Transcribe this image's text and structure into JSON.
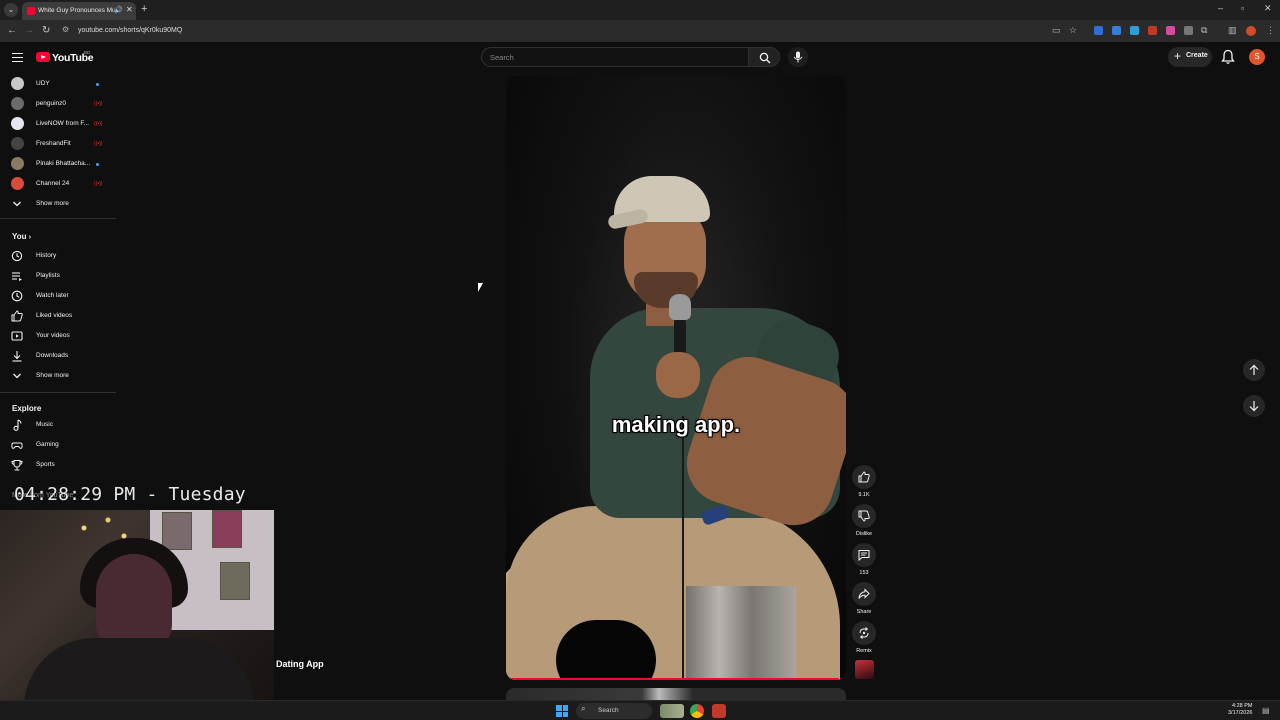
{
  "browser": {
    "tab_title": "White Guy Pronounces Mu",
    "url": "youtube.com/shorts/qKr0ku90MQ"
  },
  "masthead": {
    "logo_text": "YouTube",
    "country_code": "BD",
    "search_placeholder": "Search",
    "create_label": "Create",
    "avatar_letter": "S"
  },
  "sidebar": {
    "subscriptions": [
      {
        "label": "UDY",
        "indicator": "dot",
        "color": "#c9c9c9"
      },
      {
        "label": "penguinz0",
        "indicator": "live",
        "color": "#6b6b6b"
      },
      {
        "label": "LiveNOW from F...",
        "indicator": "live",
        "color": "#e6e6f0"
      },
      {
        "label": "FreshandFit",
        "indicator": "live",
        "color": "#444444"
      },
      {
        "label": "Pinaki Bhattacha...",
        "indicator": "dot",
        "color": "#8a7a62"
      },
      {
        "label": "Channel 24",
        "indicator": "live",
        "color": "#d94b3a"
      }
    ],
    "subs_show_more": "Show more",
    "you_title": "You",
    "you_items": [
      {
        "label": "History",
        "icon": "history-icon"
      },
      {
        "label": "Playlists",
        "icon": "playlists-icon"
      },
      {
        "label": "Watch later",
        "icon": "watch-later-icon"
      },
      {
        "label": "Liked videos",
        "icon": "like-icon"
      },
      {
        "label": "Your videos",
        "icon": "your-videos-icon"
      },
      {
        "label": "Downloads",
        "icon": "download-icon"
      }
    ],
    "you_show_more": "Show more",
    "explore_title": "Explore",
    "explore_items": [
      {
        "label": "Music",
        "icon": "music-icon"
      },
      {
        "label": "Gaming",
        "icon": "gaming-icon"
      },
      {
        "label": "Sports",
        "icon": "trophy-icon"
      }
    ],
    "more_title": "More from YouTube"
  },
  "overlay": {
    "clock_text": "04:28:29 PM - Tuesday",
    "video_title_fragment": "Dating App"
  },
  "short": {
    "caption": "making app.",
    "progress": 0.98,
    "actions": [
      {
        "name": "like",
        "label": "9.1K",
        "icon": "thumbs-up-icon"
      },
      {
        "name": "dislike",
        "label": "Dislike",
        "icon": "thumbs-down-icon"
      },
      {
        "name": "comments",
        "label": "153",
        "icon": "comment-icon"
      },
      {
        "name": "share",
        "label": "Share",
        "icon": "share-icon"
      },
      {
        "name": "remix",
        "label": "Remix",
        "icon": "remix-icon"
      }
    ]
  },
  "taskbar": {
    "search_label": "Search",
    "time": "4:28 PM",
    "date": "3/17/2026"
  },
  "colors": {
    "accent_red": "#ff0033",
    "background": "#0f0f0f",
    "link_blue": "#3ea6ff"
  }
}
